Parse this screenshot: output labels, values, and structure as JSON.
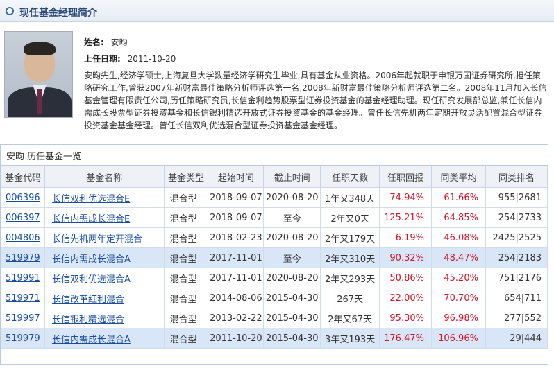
{
  "header": {
    "title": "现任基金经理简介"
  },
  "manager": {
    "name_label": "姓名:",
    "name": "安昀",
    "start_label": "上任日期:",
    "start_date": "2011-10-20",
    "bio": "安昀先生,经济学硕士,上海复旦大学数量经济学研究生毕业,具有基金从业资格。2006年起就职于申银万国证券研究所,担任策略研究工作,曾获2007年新财富最佳策略分析师评选第一名,2008年新财富最佳策略分析师评选第二名。2008年11月加入长信基金管理有限责任公司,历任策略研究员,长信金利趋势股票型证券投资基金的基金经理助理。现任研究发展部总监,兼任长信内需成长股票型证券投资基金和长信银利精选开放式证券投资基金的基金经理。曾任长信先机两年定期开放灵活配置混合型证券投资基金基金经理。曾任长信双利优选混合型证券投资基金基金经理。"
  },
  "history": {
    "caption": "安昀 历任基金一览",
    "columns": [
      "基金代码",
      "基金名称",
      "基金类型",
      "起始时间",
      "截止时间",
      "任职天数",
      "任职回报",
      "同类平均",
      "同类排名"
    ],
    "rows": [
      {
        "code": "006396",
        "name": "长信双利优选混合E",
        "type": "混合型",
        "start": "2018-09-07",
        "end": "2020-08-20",
        "days": "1年又348天",
        "ret": "74.94%",
        "avg": "61.66%",
        "rank": "955|2681",
        "hl": false
      },
      {
        "code": "006397",
        "name": "长信内需成长混合E",
        "type": "混合型",
        "start": "2018-09-07",
        "end": "至今",
        "days": "2年又0天",
        "ret": "125.21%",
        "avg": "64.85%",
        "rank": "254|2733",
        "hl": false
      },
      {
        "code": "004806",
        "name": "长信先机两年定开混合",
        "type": "混合型",
        "start": "2018-02-23",
        "end": "2020-08-20",
        "days": "2年又179天",
        "ret": "6.19%",
        "avg": "46.08%",
        "rank": "2425|2525",
        "hl": false
      },
      {
        "code": "519979",
        "name": "长信内需成长混合A",
        "type": "混合型",
        "start": "2017-11-01",
        "end": "至今",
        "days": "2年又310天",
        "ret": "90.32%",
        "avg": "48.47%",
        "rank": "254|2183",
        "hl": true
      },
      {
        "code": "519991",
        "name": "长信双利优选混合A",
        "type": "混合型",
        "start": "2017-11-01",
        "end": "2020-08-20",
        "days": "2年又293天",
        "ret": "50.86%",
        "avg": "45.20%",
        "rank": "751|2176",
        "hl": false
      },
      {
        "code": "519971",
        "name": "长信改革红利混合",
        "type": "混合型",
        "start": "2014-08-06",
        "end": "2015-04-30",
        "days": "267天",
        "ret": "22.00%",
        "avg": "70.70%",
        "rank": "654|711",
        "hl": false
      },
      {
        "code": "519997",
        "name": "长信银利精选混合",
        "type": "混合型",
        "start": "2013-02-22",
        "end": "2015-04-30",
        "days": "2年又67天",
        "ret": "95.30%",
        "avg": "96.98%",
        "rank": "277|552",
        "hl": false
      },
      {
        "code": "519979",
        "name": "长信内需成长混合A",
        "type": "混合型",
        "start": "2011-10-20",
        "end": "2015-04-30",
        "days": "3年又193天",
        "ret": "176.47%",
        "avg": "106.96%",
        "rank": "29|444",
        "hl": true
      }
    ]
  },
  "colors": {
    "accent": "#2b6cb0",
    "link": "#1a4fa0",
    "return_red": "#d0152a",
    "highlight_row": "#d9e6f7"
  }
}
